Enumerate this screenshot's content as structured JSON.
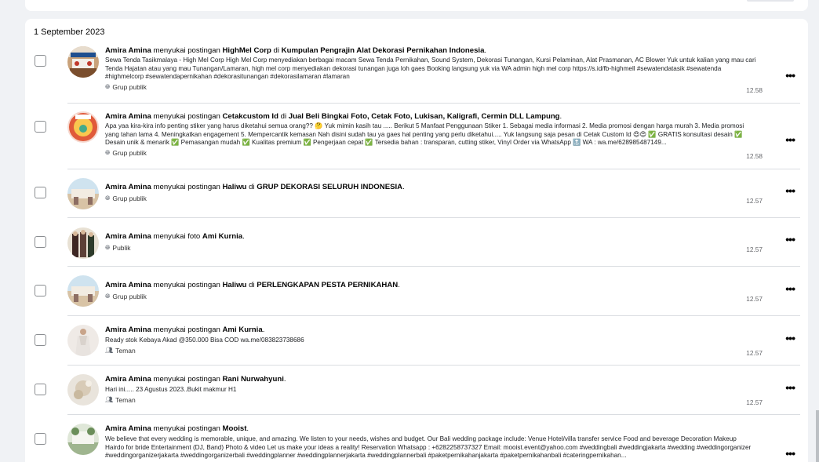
{
  "date_header": "1 September 2023",
  "entries": [
    {
      "actor": "Amira Amina",
      "action": " menyukai postingan ",
      "target": "HighMel Corp",
      "connector": " di ",
      "group": "Kumpulan Pengrajin Alat Dekorasi Pernikahan Indonesia",
      "end": ".",
      "desc": "Sewa Tenda Tasikmalaya - High Mel Corp High Mel Corp menyediakan berbagai macam Sewa Tenda Pernikahan, Sound System, Dekorasi Tunangan, Kursi Pelaminan, Alat Prasmanan, AC Blower Yuk untuk kalian yang mau cari Tenda Hajatan atau yang mau Tunangan/Lamaran, high mel corp menyediakan dekorasi tunangan juga loh gaes Booking langsung yuk via WA admin high mel corp https://s.id/fb-highmell #sewatendatasik #sewatenda #highmelcorp #sewatendapernikahan #dekorasitunangan #dekorasilamaran #lamaran",
      "audience": "Grup publik",
      "audience_icon": "globe-icon",
      "time": "12.58"
    },
    {
      "actor": "Amira Amina",
      "action": " menyukai postingan ",
      "target": "Cetakcustom Id",
      "connector": " di ",
      "group": "Jual Beli Bingkai Foto, Cetak Foto, Lukisan, Kaligrafi, Cermin DLL Lampung",
      "end": ".",
      "desc": "Apa yaa kira-kira info penting stiker yang harus diketahui semua orang?? 🤔 Yuk mimin kasih tau ..... Berikut 5 Manfaat Penggunaan Stiker 1. Sebagai media informasi 2. Media promosi dengan harga murah 3. Media promosi yang tahan lama 4. Meningkatkan engagement 5. Mempercantik kemasan Nah disini sudah tau ya gaes hal penting yang perlu diketahui..... Yuk langsung saja pesan di Cetak Custom Id 😍😍 ✅ GRATIS konsultasi desain ✅ Desain unik & menarik ✅ Pemasangan mudah ✅ Kualitas premium ✅ Pengerjaan cepat ✅ Tersedia bahan : transparan, cutting stiker, Vinyl Order via WhatsApp 🔝 WA : wa.me/628985487149...",
      "audience": "Grup publik",
      "audience_icon": "globe-icon",
      "time": "12.58"
    },
    {
      "actor": "Amira Amina",
      "action": " menyukai postingan ",
      "target": "Haliwu",
      "connector": " di ",
      "group": "GRUP DEKORASI SELURUH INDONESIA",
      "end": ".",
      "desc": "",
      "audience": "Grup publik",
      "audience_icon": "globe-icon",
      "time": "12.57"
    },
    {
      "actor": "Amira Amina",
      "action": " menyukai foto ",
      "target": "Ami Kurnia",
      "connector": "",
      "group": "",
      "end": ".",
      "desc": "",
      "audience": "Publik",
      "audience_icon": "globe-icon",
      "time": "12.57"
    },
    {
      "actor": "Amira Amina",
      "action": " menyukai postingan ",
      "target": "Haliwu",
      "connector": " di ",
      "group": "PERLENGKAPAN PESTA PERNIKAHAN",
      "end": ".",
      "desc": "",
      "audience": "Grup publik",
      "audience_icon": "globe-icon",
      "time": "12.57"
    },
    {
      "actor": "Amira Amina",
      "action": " menyukai postingan ",
      "target": "Ami Kurnia",
      "connector": "",
      "group": "",
      "end": ".",
      "desc": "Ready stok Kebaya Akad @350.000 Bisa COD wa.me/083823738686",
      "audience": "Teman",
      "audience_icon": "friends-icon",
      "time": "12.57"
    },
    {
      "actor": "Amira Amina",
      "action": " menyukai postingan ",
      "target": "Rani Nurwahyuni",
      "connector": "",
      "group": "",
      "end": ".",
      "desc": "Hari ini..... 23 Agustus 2023..Bukit makmur H1",
      "audience": "Teman",
      "audience_icon": "friends-icon",
      "time": "12.57"
    },
    {
      "actor": "Amira Amina",
      "action": " menyukai postingan ",
      "target": "Mooist",
      "connector": "",
      "group": "",
      "end": ".",
      "desc": "We believe that every wedding is memorable, unique, and amazing. We listen to your needs, wishes and budget. Our Bali wedding package include: Venue Hotel/villa transfer service Food and beverage Decoration Makeup Hairdo for bride Entertainment (DJ, Band) Photo & video Let us make your ideas a reality! Reservation Whatsapp : +6282258737327 Email: mooist.event@yahoo.com #weddingbali #weddingjakarta #wedding #weddingorganizer #weddingorganizerjakarta #weddingorganizerbali #weddingplanner #weddingplannerjakarta #weddingplannerbali #paketpernikahanjakarta #paketpernikahanbali #cateringpernikahan...",
      "audience": "",
      "audience_icon": "",
      "time": ""
    }
  ],
  "more_label": "•••",
  "colors": {
    "page_bg": "#f0f2f5",
    "card_bg": "#ffffff",
    "separator": "#dadde1",
    "muted_text": "#65676b"
  }
}
